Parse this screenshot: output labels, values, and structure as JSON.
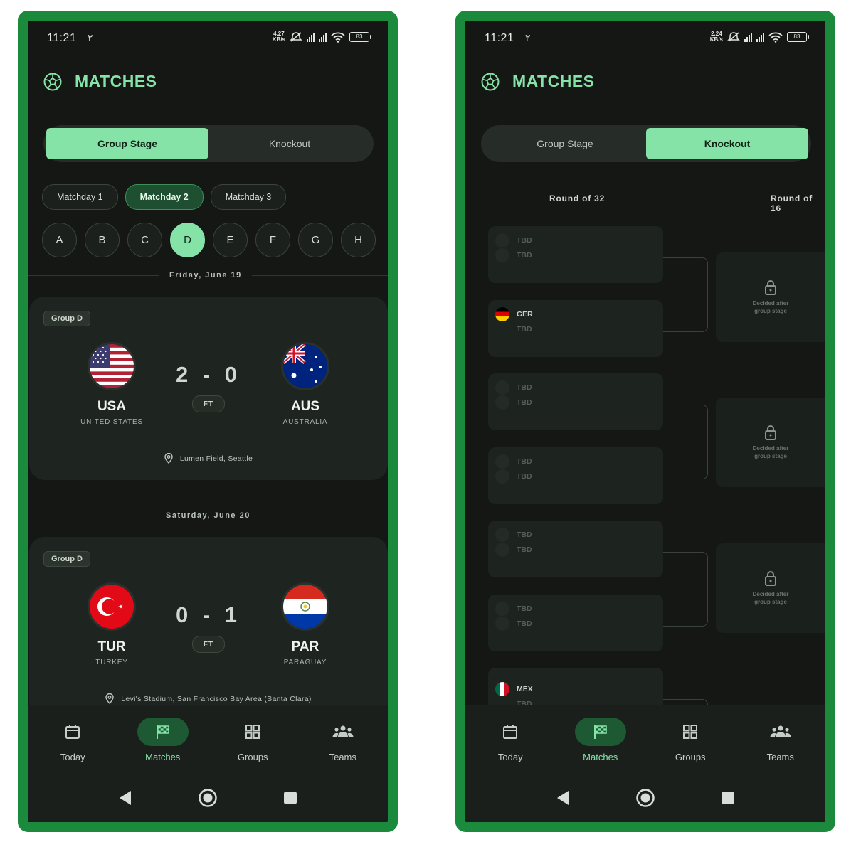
{
  "status": {
    "time": "11:21",
    "carrier_glyph": "۲",
    "kbs_left": [
      "4.27",
      "KB/s"
    ],
    "kbs_right": [
      "2.24",
      "KB/s"
    ],
    "battery": "83"
  },
  "header": {
    "title": "MATCHES"
  },
  "tabs": {
    "group_stage": "Group Stage",
    "knockout": "Knockout"
  },
  "matchdays": [
    "Matchday 1",
    "Matchday 2",
    "Matchday 3"
  ],
  "groups": [
    "A",
    "B",
    "C",
    "D",
    "E",
    "F",
    "G",
    "H"
  ],
  "dates": {
    "d1": "Friday, June 19",
    "d2": "Saturday, June 20"
  },
  "matches": [
    {
      "group": "Group D",
      "home": {
        "code": "USA",
        "name": "UNITED STATES"
      },
      "away": {
        "code": "AUS",
        "name": "AUSTRALIA"
      },
      "score": "2 - 0",
      "status": "FT",
      "venue": "Lumen Field, Seattle"
    },
    {
      "group": "Group D",
      "home": {
        "code": "TUR",
        "name": "TURKEY"
      },
      "away": {
        "code": "PAR",
        "name": "PARAGUAY"
      },
      "score": "0 - 1",
      "status": "FT",
      "venue": "Levi's Stadium, San Francisco Bay Area (Santa Clara)"
    }
  ],
  "nav": {
    "today": "Today",
    "matches": "Matches",
    "groups": "Groups",
    "teams": "Teams"
  },
  "bracket": {
    "round32": "Round of 32",
    "round16": "Round of 16",
    "slots": [
      [
        "TBD",
        "TBD"
      ],
      [
        "GER",
        "TBD"
      ],
      [
        "TBD",
        "TBD"
      ],
      [
        "TBD",
        "TBD"
      ],
      [
        "TBD",
        "TBD"
      ],
      [
        "TBD",
        "TBD"
      ],
      [
        "MEX",
        "TBD"
      ]
    ],
    "decided_line1": "Decided after",
    "decided_line2": "group stage"
  },
  "colors": {
    "accent": "#86e3a8",
    "frame": "#1c8a3c",
    "background": "#141714"
  }
}
